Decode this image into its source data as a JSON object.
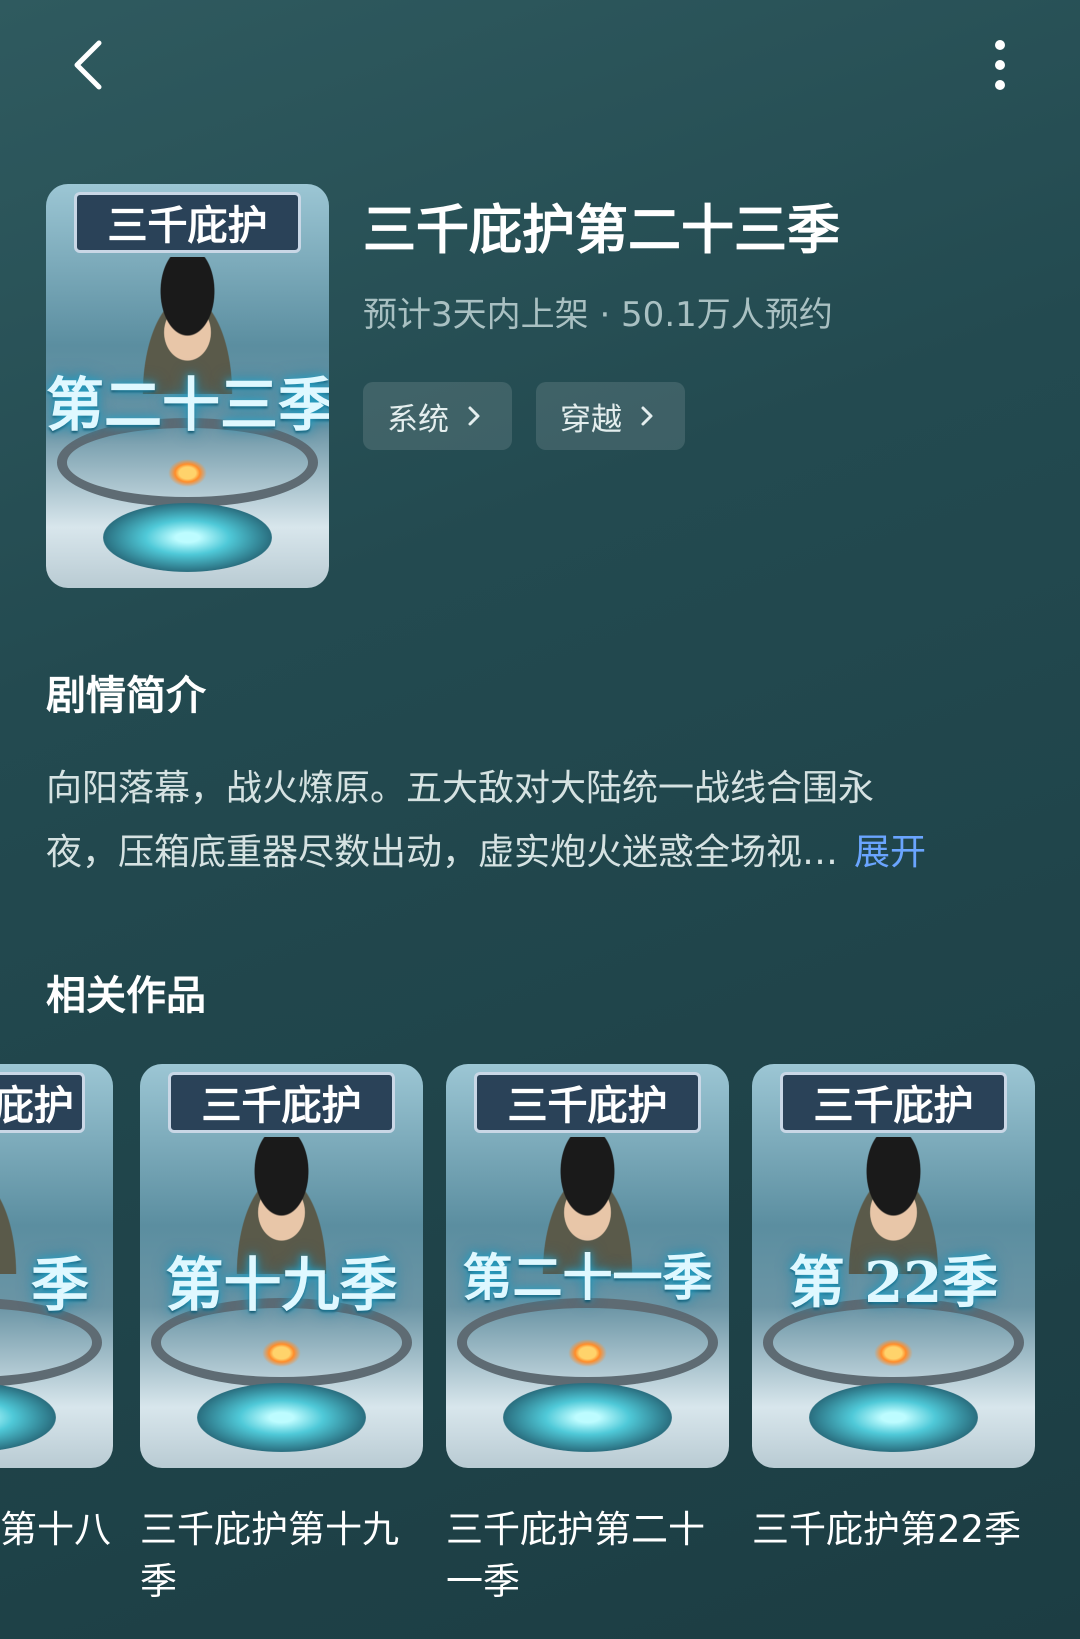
{
  "topbar": {
    "back_icon": "chevron-left-icon",
    "more_icon": "more-vertical-icon"
  },
  "hero": {
    "cover_banner": "三千庇护",
    "cover_season": "第二十三季",
    "title": "三千庇护第二十三季",
    "meta": "预计3天内上架 · 50.1万人预约",
    "tags": [
      "系统",
      "穿越"
    ]
  },
  "synopsis": {
    "heading": "剧情简介",
    "line1": "向阳落幕，战火燎原。五大敌对大陆统一战线合围永",
    "line2": "夜，压箱底重器尽数出动，虚实炮火迷惑全场视…",
    "expand_label": "展开"
  },
  "related": {
    "heading": "相关作品",
    "items": [
      {
        "cover_banner": "庇护",
        "cover_season": "季",
        "title": "第十八"
      },
      {
        "cover_banner": "三千庇护",
        "cover_season": "第十九季",
        "title": "三千庇护第十九季"
      },
      {
        "cover_banner": "三千庇护",
        "cover_season": "第二十一季",
        "title": "三千庇护第二十一季"
      },
      {
        "cover_banner": "三千庇护",
        "cover_season": "第 22季",
        "title": "三千庇护第22季"
      }
    ]
  }
}
